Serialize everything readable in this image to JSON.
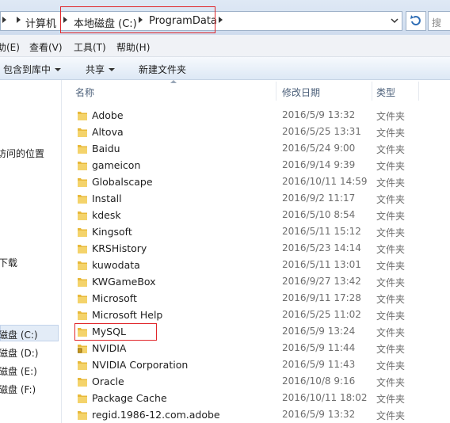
{
  "address_bar": {
    "crumbs": [
      "计算机",
      "本地磁盘 (C:)",
      "ProgramData"
    ],
    "search_placeholder": "搜"
  },
  "menubar": {
    "items": [
      "助(E)",
      "查看(V)",
      "工具(T)",
      "帮助(H)"
    ]
  },
  "toolbar": {
    "include_label": "包含到库中",
    "share_label": "共享",
    "new_folder_label": "新建文件夹"
  },
  "nav": {
    "items": [
      "访问的位置",
      "下载",
      "磁盘 (C:)",
      "磁盘 (D:)",
      "磁盘 (E:)",
      "磁盘 (F:)"
    ]
  },
  "columns": {
    "name": "名称",
    "modified": "修改日期",
    "type": "类型"
  },
  "files": [
    {
      "name": "Adobe",
      "date": "2016/5/9 13:32",
      "type": "文件夹",
      "locked": false
    },
    {
      "name": "Altova",
      "date": "2016/5/25 13:31",
      "type": "文件夹",
      "locked": false
    },
    {
      "name": "Baidu",
      "date": "2016/5/24 9:00",
      "type": "文件夹",
      "locked": false
    },
    {
      "name": "gameicon",
      "date": "2016/9/14 9:39",
      "type": "文件夹",
      "locked": false
    },
    {
      "name": "Globalscape",
      "date": "2016/10/11 14:59",
      "type": "文件夹",
      "locked": false
    },
    {
      "name": "Install",
      "date": "2016/9/2 11:17",
      "type": "文件夹",
      "locked": false
    },
    {
      "name": "kdesk",
      "date": "2016/5/10 8:54",
      "type": "文件夹",
      "locked": false
    },
    {
      "name": "Kingsoft",
      "date": "2016/5/11 15:12",
      "type": "文件夹",
      "locked": false
    },
    {
      "name": "KRSHistory",
      "date": "2016/5/23 14:14",
      "type": "文件夹",
      "locked": false
    },
    {
      "name": "kuwodata",
      "date": "2016/5/11 13:01",
      "type": "文件夹",
      "locked": false
    },
    {
      "name": "KWGameBox",
      "date": "2016/9/27 13:42",
      "type": "文件夹",
      "locked": false
    },
    {
      "name": "Microsoft",
      "date": "2016/9/11 17:28",
      "type": "文件夹",
      "locked": false
    },
    {
      "name": "Microsoft Help",
      "date": "2016/5/25 11:02",
      "type": "文件夹",
      "locked": false
    },
    {
      "name": "MySQL",
      "date": "2016/5/9 13:24",
      "type": "文件夹",
      "locked": false
    },
    {
      "name": "NVIDIA",
      "date": "2016/5/9 11:44",
      "type": "文件夹",
      "locked": true
    },
    {
      "name": "NVIDIA Corporation",
      "date": "2016/5/9 11:43",
      "type": "文件夹",
      "locked": false
    },
    {
      "name": "Oracle",
      "date": "2016/10/8 9:16",
      "type": "文件夹",
      "locked": false
    },
    {
      "name": "Package Cache",
      "date": "2016/10/11 18:02",
      "type": "文件夹",
      "locked": false
    },
    {
      "name": "regid.1986-12.com.adobe",
      "date": "2016/5/9 13:32",
      "type": "文件夹",
      "locked": false
    }
  ],
  "colors": {
    "highlight_box": "#e0262a",
    "folder": "#e8b93a",
    "selected_nav": "#e3ecf7"
  }
}
